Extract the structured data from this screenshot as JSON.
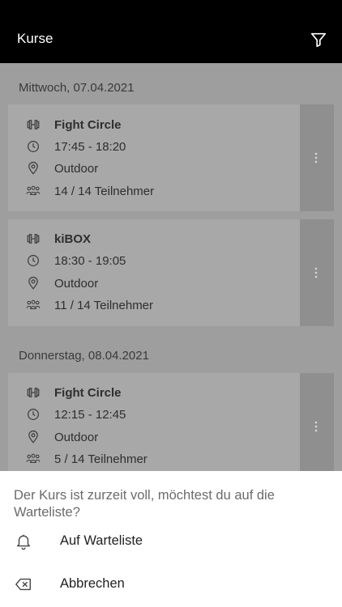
{
  "appbar": {
    "title": "Kurse",
    "filter_icon": "filter-icon"
  },
  "days": [
    {
      "date": "Mittwoch, 07.04.2021",
      "courses": [
        {
          "name": "Fight Circle",
          "time": "17:45 - 18:20",
          "location": "Outdoor",
          "participants": "14 / 14 Teilnehmer"
        },
        {
          "name": "kiBOX",
          "time": "18:30 - 19:05",
          "location": "Outdoor",
          "participants": "11 / 14 Teilnehmer"
        }
      ]
    },
    {
      "date": "Donnerstag, 08.04.2021",
      "courses": [
        {
          "name": "Fight Circle",
          "time": "12:15 - 12:45",
          "location": "Outdoor",
          "participants": "5 / 14 Teilnehmer"
        }
      ]
    }
  ],
  "sheet": {
    "message": "Der Kurs ist zurzeit voll, möchtest du auf die Warteliste?",
    "actions": [
      {
        "label": "Auf Warteliste",
        "icon": "bell-icon"
      },
      {
        "label": "Abbrechen",
        "icon": "backspace-x-icon"
      }
    ]
  },
  "colors": {
    "appbar": "#000000",
    "overlay": "#9e9e9e",
    "card": "#a8a8a8",
    "menu_strip": "#8f8f8f",
    "sheet": "#ffffff"
  }
}
